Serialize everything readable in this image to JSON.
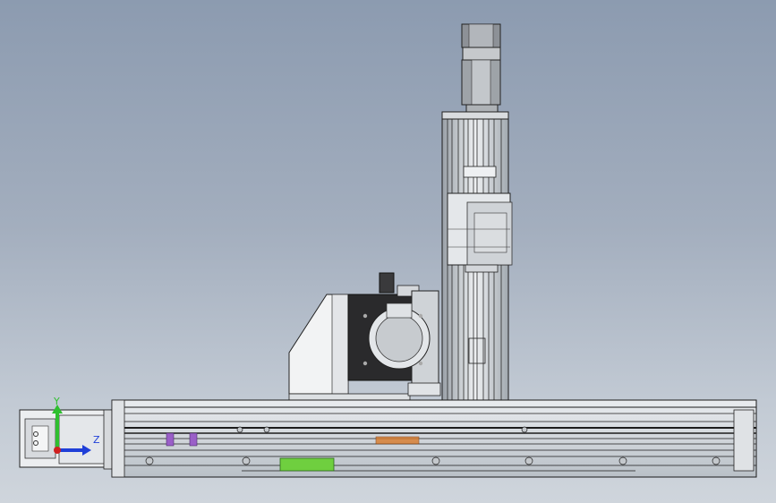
{
  "viewport": {
    "triad": {
      "y_label": "Y",
      "z_label": "Z",
      "y_color": "#2fbf2f",
      "z_color": "#1f3fd8",
      "x_color": "#d02020"
    },
    "colors": {
      "background_top": "#8c9bb0",
      "background_bottom": "#cfd5dc",
      "metal_light": "#e6e9ec",
      "metal_mid": "#b8bec5",
      "line_dark": "#1a1a1a",
      "highlight_orange": "#d87a2a",
      "highlight_green": "#6fcf3f",
      "highlight_purple": "#9a5fc8"
    }
  }
}
